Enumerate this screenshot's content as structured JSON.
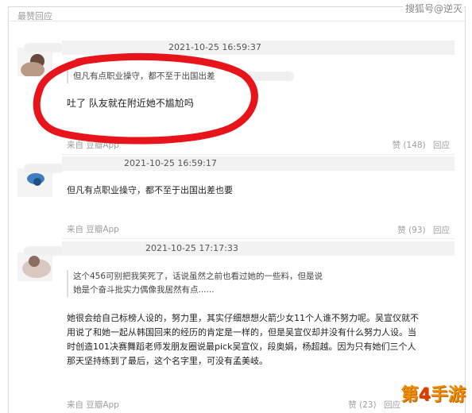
{
  "header": {
    "section_label": "最赞回应",
    "watermark": "搜狐号@逆灭"
  },
  "comments": [
    {
      "timestamp": "2021-10-25 16:59:37",
      "quote": "但凡有点职业操守，都不至于出国出差",
      "text": "吐了 队友就在附近她不尴尬吗",
      "source": "来自 豆瓣App",
      "likes": "赞 (148)",
      "reply": "回应"
    },
    {
      "timestamp": "2021-10-25 16:59:17",
      "text": "但凡有点职业操守，都不至于出国出差也要",
      "source": "来自 豆瓣App",
      "likes": "赞 (93)",
      "reply": "回应"
    },
    {
      "timestamp": "2021-10-25 17:17:33",
      "quote_line1": "这个456可别把我笑死了，话说虽然之前也看过她的一些料，但是说",
      "quote_line2": "她是个奋斗批实力偶像我居然有点......",
      "text_line1": "她很会给自己标榜人设的，努力里，其实仔细想想火箭少女11个人谁不努力呢。吴宣仪就不",
      "text_line2": "用说了和她一起从韩国回来的经历的肯定是一样的，但是吴宣仪却并没有什么努力人设。当",
      "text_line3": "时创造101决赛舞蹈老师发朋友圈说最pick吴宣仪，段奥娟，杨超越。因为只有她们三个人",
      "text_line4": "那天坚持练到了最后，这个名字里，可没有孟美岐。",
      "source": "来自 豆瓣App",
      "likes": "赞 (23)",
      "reply": "回应"
    }
  ],
  "brand": {
    "logo_prefix": "第",
    "logo_num": "4",
    "logo_suffix": "手游"
  },
  "colors": {
    "highlight_circle": "#e8141c",
    "logo": "#f08c00"
  }
}
